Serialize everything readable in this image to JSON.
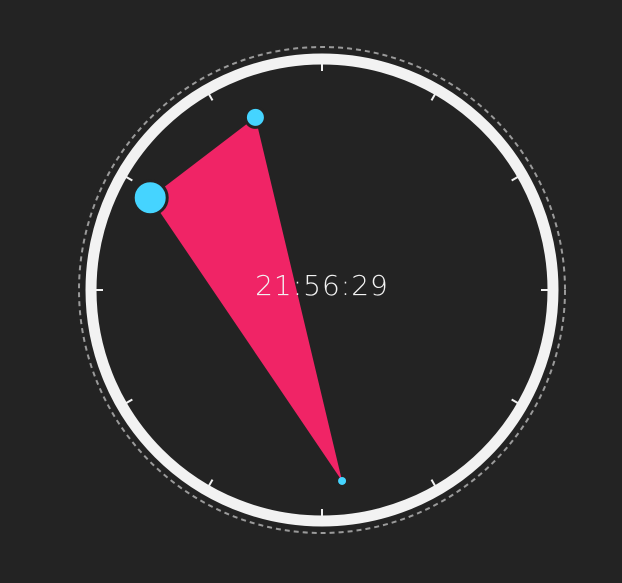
{
  "clock": {
    "time_text": "21:56:29",
    "hour": 21,
    "minute": 56,
    "second": 29,
    "colors": {
      "background": "#232323",
      "face_ring": "#f2f2f2",
      "dashed_ring": "#9a9a9a",
      "tick": "#f2f2f2",
      "hand_dot": "#45d4ff",
      "triangle_fill": "#f02466"
    },
    "tick_count": 12
  }
}
